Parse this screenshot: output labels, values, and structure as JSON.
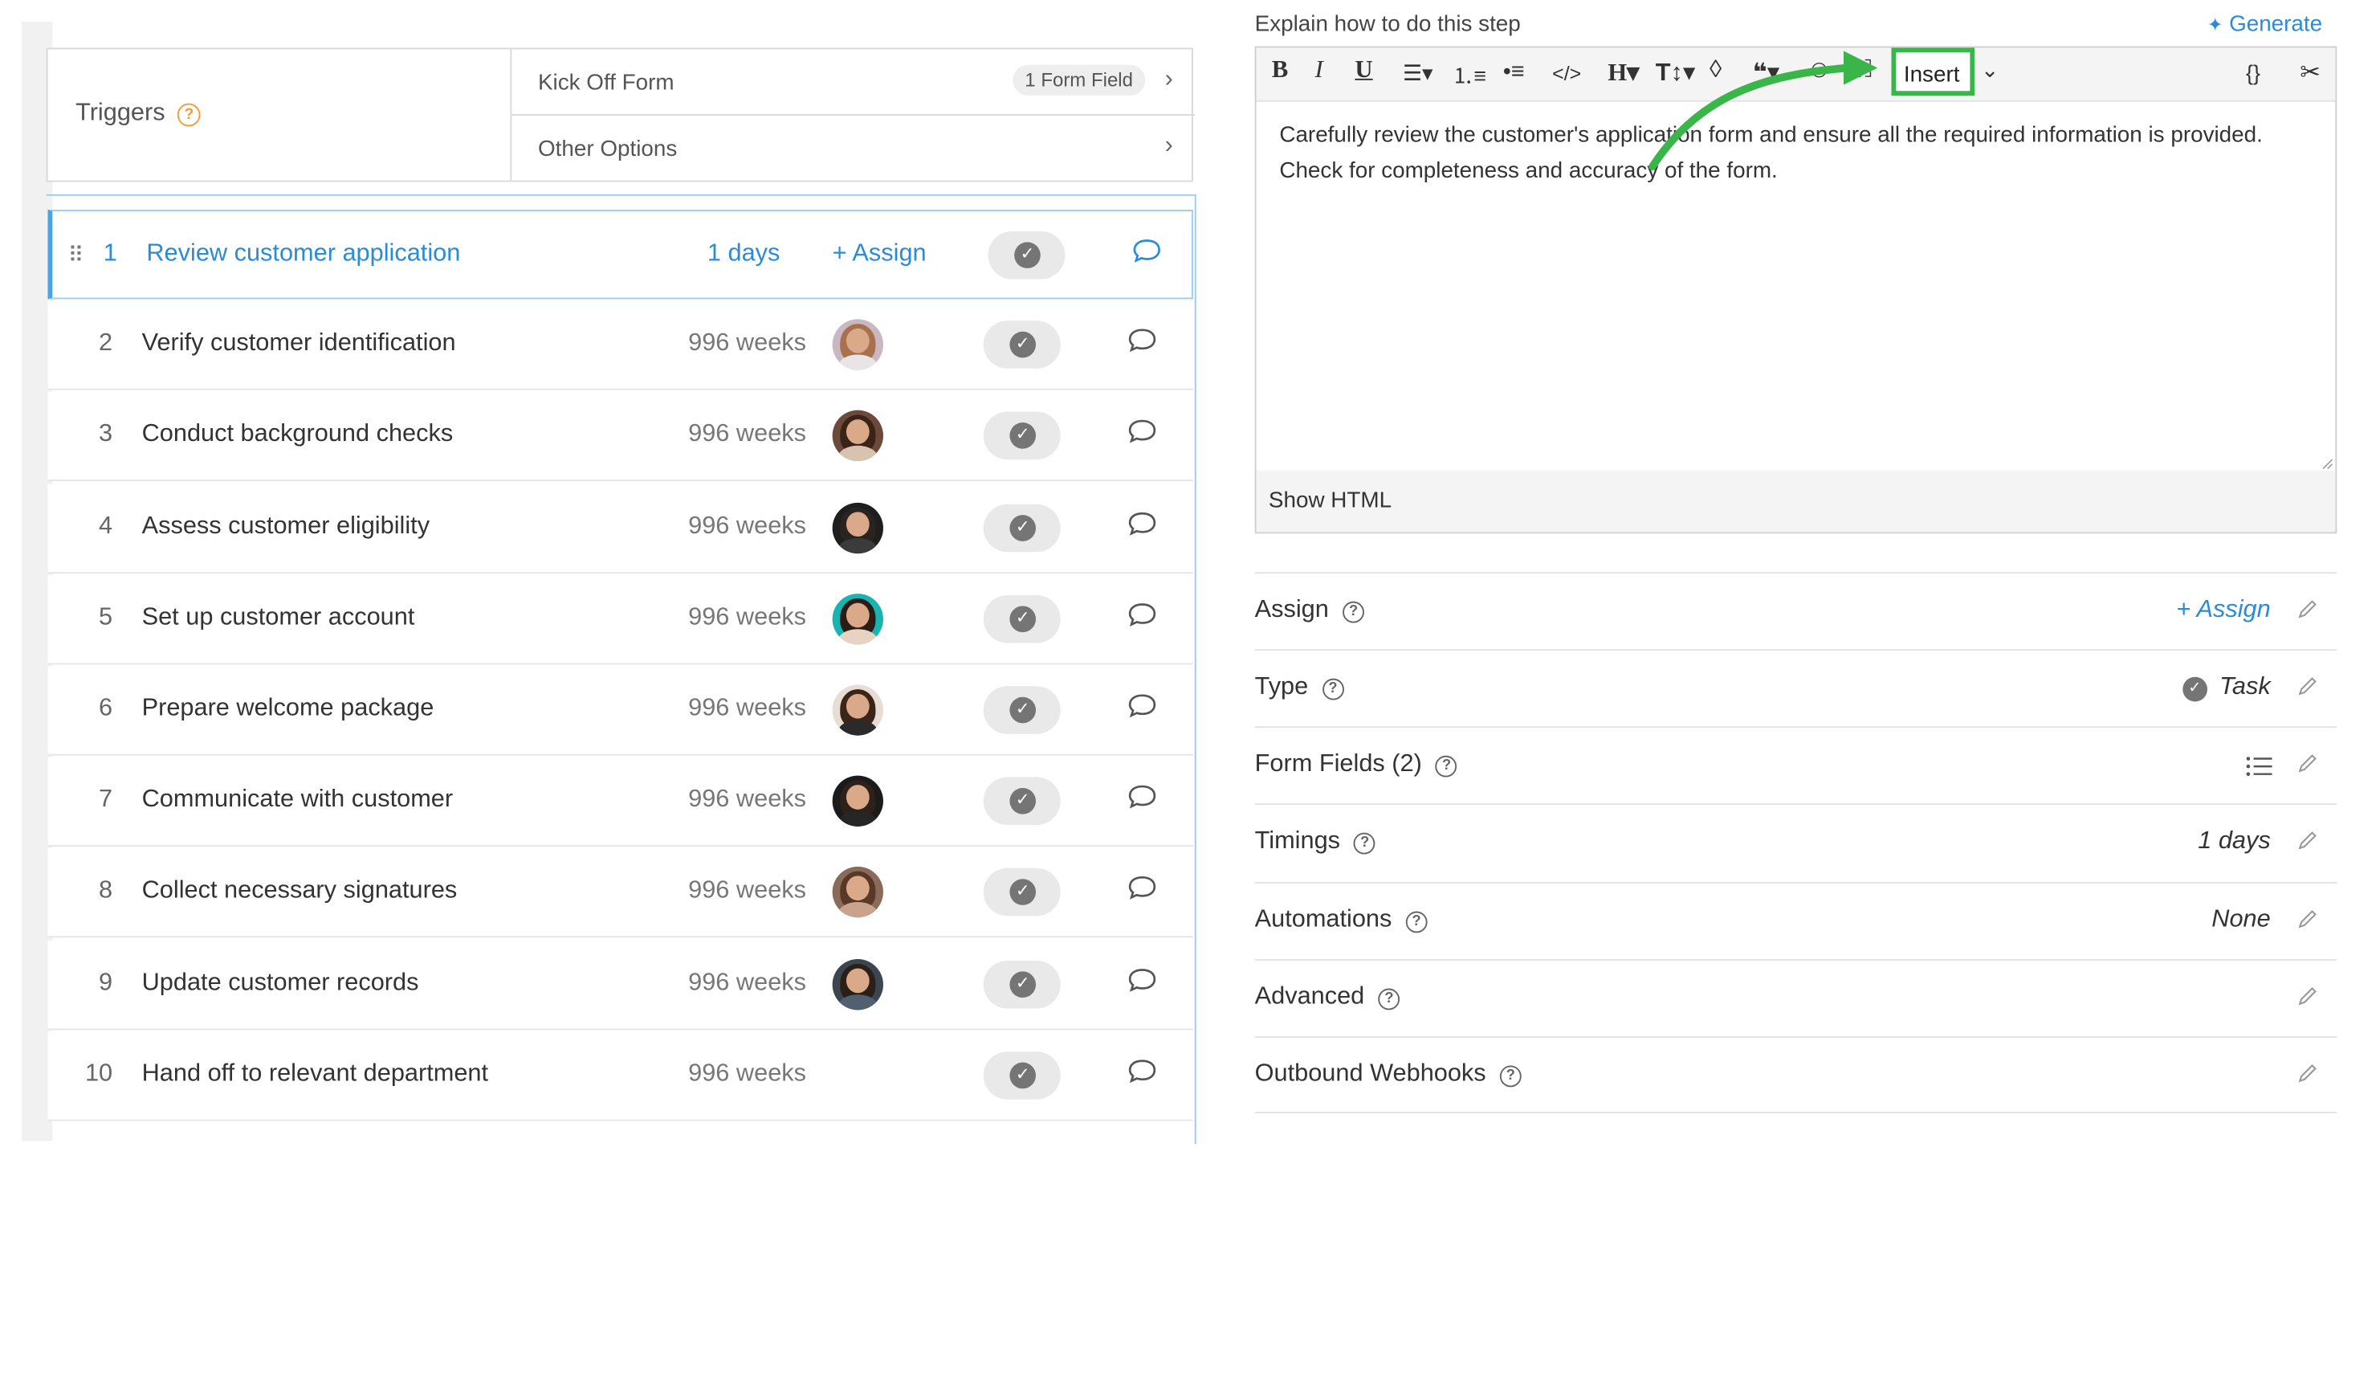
{
  "triggers": {
    "label": "Triggers",
    "kickoff_label": "Kick Off Form",
    "kickoff_badge": "1 Form Field",
    "other_label": "Other Options"
  },
  "steps": [
    {
      "num": "1",
      "title": "Review customer application",
      "duration": "1 days",
      "assign": "+ Assign",
      "avatar": null,
      "active": true
    },
    {
      "num": "2",
      "title": "Verify customer identification",
      "duration": "996 weeks",
      "avatar": "avatar-1"
    },
    {
      "num": "3",
      "title": "Conduct background checks",
      "duration": "996 weeks",
      "avatar": "avatar-2"
    },
    {
      "num": "4",
      "title": "Assess customer eligibility",
      "duration": "996 weeks",
      "avatar": "avatar-3"
    },
    {
      "num": "5",
      "title": "Set up customer account",
      "duration": "996 weeks",
      "avatar": "avatar-4"
    },
    {
      "num": "6",
      "title": "Prepare welcome package",
      "duration": "996 weeks",
      "avatar": "avatar-5"
    },
    {
      "num": "7",
      "title": "Communicate with customer",
      "duration": "996 weeks",
      "avatar": "avatar-6"
    },
    {
      "num": "8",
      "title": "Collect necessary signatures",
      "duration": "996 weeks",
      "avatar": "avatar-7"
    },
    {
      "num": "9",
      "title": "Update customer records",
      "duration": "996 weeks",
      "avatar": "avatar-8"
    },
    {
      "num": "10",
      "title": "Hand off to relevant department",
      "duration": "996 weeks",
      "avatar": null
    }
  ],
  "editor": {
    "explain_label": "Explain how to do this step",
    "generate_label": "Generate",
    "insert_label": "Insert",
    "content": "Carefully review the customer's application form and ensure all the required information is provided. Check for completeness and accuracy of the form.",
    "show_html": "Show HTML"
  },
  "properties": {
    "assign": {
      "label": "Assign",
      "value": "+ Assign"
    },
    "type": {
      "label": "Type",
      "value": "Task"
    },
    "form_fields": {
      "label": "Form Fields (2)"
    },
    "timings": {
      "label": "Timings",
      "value": "1 days"
    },
    "automations": {
      "label": "Automations",
      "value": "None"
    },
    "advanced": {
      "label": "Advanced"
    },
    "outbound_webhooks": {
      "label": "Outbound Webhooks"
    }
  },
  "colors": {
    "accent_blue": "#2b8bd6",
    "highlight_green": "#3ab54a",
    "help_orange": "#f29d38"
  }
}
